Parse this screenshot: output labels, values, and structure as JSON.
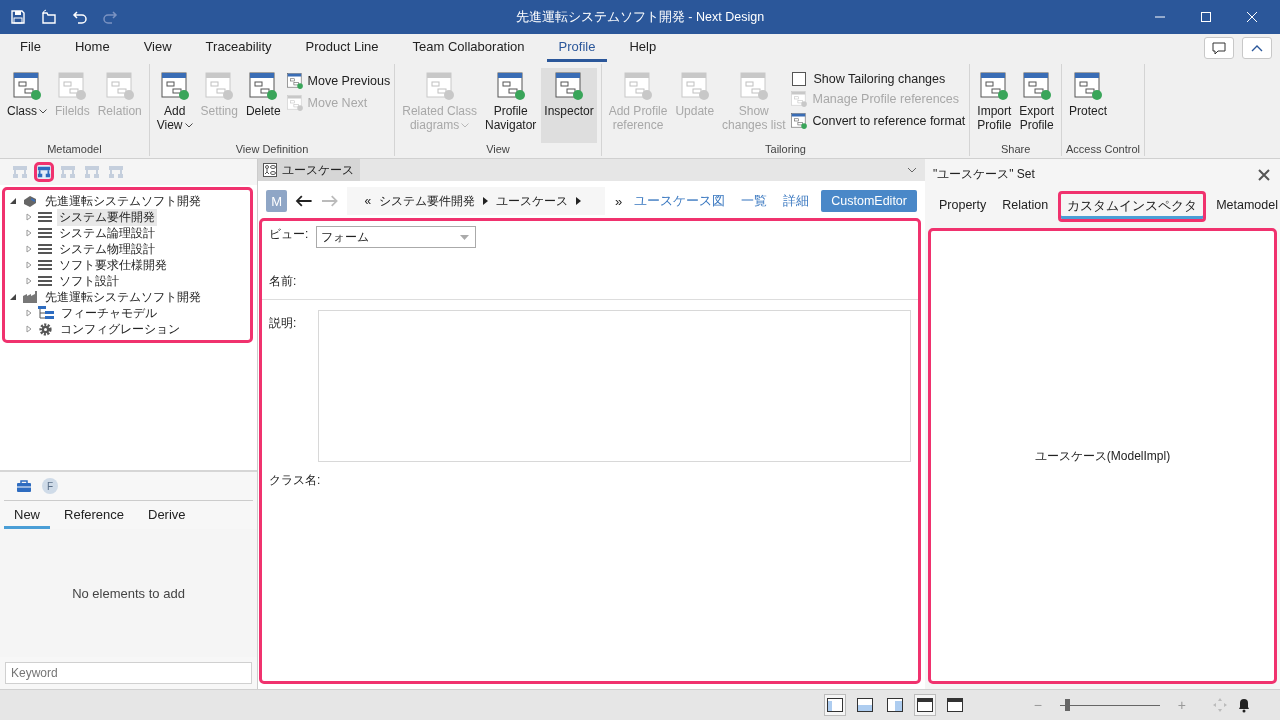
{
  "window": {
    "title": "先進運転システムソフト開発 - Next Design"
  },
  "menu_tabs": [
    {
      "label": "File",
      "selected": false
    },
    {
      "label": "Home",
      "selected": false
    },
    {
      "label": "View",
      "selected": false
    },
    {
      "label": "Traceability",
      "selected": false
    },
    {
      "label": "Product Line",
      "selected": false
    },
    {
      "label": "Team Collaboration",
      "selected": false
    },
    {
      "label": "Profile",
      "selected": true
    },
    {
      "label": "Help",
      "selected": false
    }
  ],
  "ribbon": [
    {
      "label": "Metamodel",
      "items": [
        {
          "kind": "large",
          "label": "Class",
          "dropdown": true,
          "disabled": false,
          "selected": false
        },
        {
          "kind": "large",
          "label": "Filelds",
          "dropdown": false,
          "disabled": true,
          "selected": false
        },
        {
          "kind": "large",
          "label": "Relation",
          "dropdown": false,
          "disabled": true,
          "selected": false
        }
      ]
    },
    {
      "label": "View Definition",
      "items": [
        {
          "kind": "large",
          "label": "Add\nView",
          "dropdown": true,
          "disabled": false,
          "selected": false
        },
        {
          "kind": "large",
          "label": "Setting",
          "dropdown": false,
          "disabled": true,
          "selected": false
        },
        {
          "kind": "large",
          "label": "Delete",
          "dropdown": false,
          "disabled": false,
          "selected": false
        },
        {
          "kind": "stack",
          "items": [
            {
              "kind": "small",
              "label": "Move Previous",
              "disabled": false
            },
            {
              "kind": "small",
              "label": "Move Next",
              "disabled": true
            }
          ]
        }
      ]
    },
    {
      "label": "View",
      "items": [
        {
          "kind": "large",
          "label": "Related Class\ndiagrams",
          "dropdown": true,
          "disabled": true,
          "selected": false
        },
        {
          "kind": "large",
          "label": "Profile\nNavigator",
          "dropdown": false,
          "disabled": false,
          "selected": false
        },
        {
          "kind": "large",
          "label": "Inspector",
          "dropdown": false,
          "disabled": false,
          "selected": true
        }
      ]
    },
    {
      "label": "Tailoring",
      "items": [
        {
          "kind": "large",
          "label": "Add Profile\nreference",
          "dropdown": false,
          "disabled": true,
          "selected": false
        },
        {
          "kind": "large",
          "label": "Update",
          "dropdown": false,
          "disabled": true,
          "selected": false
        },
        {
          "kind": "large",
          "label": "Show\nchanges list",
          "dropdown": false,
          "disabled": true,
          "selected": false
        },
        {
          "kind": "stack",
          "items": [
            {
              "kind": "check",
              "label": "Show Tailoring changes",
              "checked": false,
              "disabled": false
            },
            {
              "kind": "small",
              "label": "Manage Profile references",
              "disabled": true
            },
            {
              "kind": "small",
              "label": "Convert to reference format",
              "disabled": false
            }
          ]
        }
      ]
    },
    {
      "label": "Share",
      "items": [
        {
          "kind": "large",
          "label": "Import\nProfile",
          "dropdown": false,
          "disabled": false,
          "selected": false
        },
        {
          "kind": "large",
          "label": "Export\nProfile",
          "dropdown": false,
          "disabled": false,
          "selected": false
        }
      ]
    },
    {
      "label": "Access Control",
      "items": [
        {
          "kind": "large",
          "label": "Protect",
          "dropdown": false,
          "disabled": false,
          "selected": false
        }
      ]
    }
  ],
  "tree_toolbar": [
    {
      "selected": false,
      "disabled": true,
      "highlighted": false
    },
    {
      "selected": true,
      "disabled": false,
      "highlighted": true
    },
    {
      "selected": false,
      "disabled": true,
      "highlighted": false
    },
    {
      "selected": false,
      "disabled": true,
      "highlighted": false
    },
    {
      "selected": false,
      "disabled": true,
      "highlighted": false
    }
  ],
  "tree": {
    "highlighted": true,
    "items": [
      {
        "kind": "project",
        "label": "先進運転システムソフト開発",
        "expanded": true,
        "selected": false,
        "children": [
          {
            "kind": "model",
            "label": "システム要件開発",
            "expanded": false,
            "selected": true
          },
          {
            "kind": "model",
            "label": "システム論理設計",
            "expanded": false,
            "selected": false
          },
          {
            "kind": "model",
            "label": "システム物理設計",
            "expanded": false,
            "selected": false
          },
          {
            "kind": "model",
            "label": "ソフト要求仕様開発",
            "expanded": false,
            "selected": false
          },
          {
            "kind": "model",
            "label": "ソフト設計",
            "expanded": false,
            "selected": false
          }
        ]
      },
      {
        "kind": "product_line",
        "label": "先進運転システムソフト開発",
        "expanded": true,
        "selected": false,
        "children": [
          {
            "kind": "feature_model",
            "label": "フィーチャモデル",
            "expanded": false,
            "selected": false
          },
          {
            "kind": "configuration",
            "label": "コンフィグレーション",
            "expanded": false,
            "selected": false
          }
        ]
      }
    ]
  },
  "element_panel": {
    "badge": "F",
    "tabs": [
      {
        "label": "New",
        "selected": true
      },
      {
        "label": "Reference",
        "selected": false
      },
      {
        "label": "Derive",
        "selected": false
      }
    ],
    "message": "No elements to add",
    "search": {
      "placeholder": "Keyword"
    }
  },
  "document_tab": {
    "title": "ユースケース"
  },
  "nav": {
    "badge": "M",
    "back_disabled": false,
    "forward_disabled": true,
    "left_glyph": "«",
    "breadcrumb": [
      "システム要件開発",
      "ユースケース"
    ],
    "right_glyph": "»",
    "views": [
      {
        "label": "ユースケース図",
        "selected": false
      },
      {
        "label": "一覧",
        "selected": false
      },
      {
        "label": "詳細",
        "selected": false
      },
      {
        "label": "CustomEditor",
        "selected": true
      }
    ]
  },
  "form": {
    "highlighted": true,
    "view_label": "ビュー:",
    "view_value": "フォーム",
    "name_label": "名前:",
    "description_label": "説明:",
    "class_label": "クラス名:"
  },
  "inspector": {
    "title": "\"ユースケース\" Set",
    "tabs": [
      {
        "label": "Property",
        "selected": false,
        "highlighted": false
      },
      {
        "label": "Relation",
        "selected": false,
        "highlighted": false
      },
      {
        "label": "カスタムインスペクタ",
        "selected": true,
        "highlighted": true
      },
      {
        "label": "Metamodel",
        "selected": false,
        "highlighted": false
      }
    ],
    "highlighted": true,
    "content": "ユースケース(ModelImpl)"
  },
  "status_bar": {
    "layouts": [
      {
        "selected": true
      },
      {
        "selected": false
      },
      {
        "selected": false
      },
      {
        "selected": true
      },
      {
        "selected": false
      }
    ],
    "zoom_minus": "−",
    "zoom_plus": "+",
    "zoom": {
      "level": 0.05
    }
  }
}
